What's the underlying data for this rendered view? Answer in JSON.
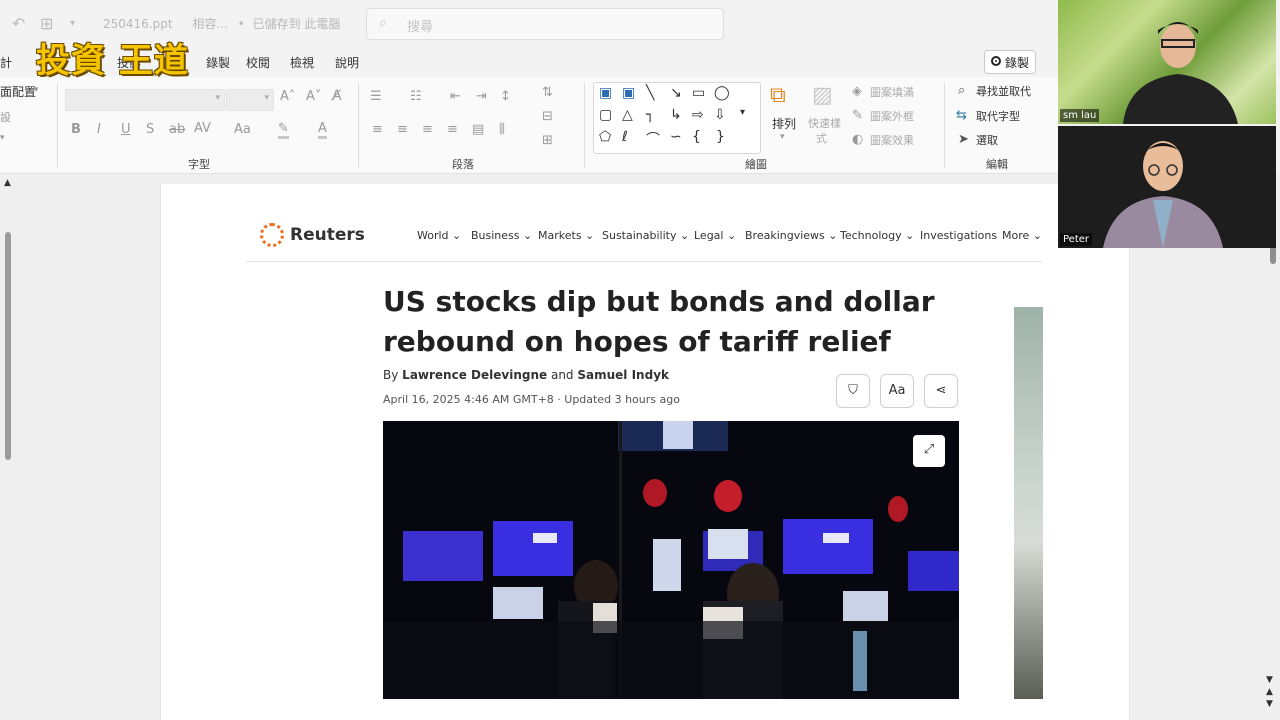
{
  "window": {
    "filename": "250416.ppt",
    "compat": "相容...",
    "save_status": "已儲存到 此電腦",
    "search_placeholder": "搜尋"
  },
  "channel_logo": "投資 王道",
  "menu": {
    "tabs": [
      "計",
      "繪",
      "投影",
      "檢視",
      "錄製",
      "校閱",
      "檢視",
      "說明"
    ],
    "record_label": "錄製"
  },
  "ribbon": {
    "font_group_label": "字型",
    "paragraph_group_label": "段落",
    "drawing_group_label": "繪圖",
    "editing_group_label": "編輯",
    "layout_label": "面配置",
    "arrange_label": "排列",
    "quick_styles_label_1": "快速樣",
    "quick_styles_label_2": "式",
    "shape_fill": "圖案填滿",
    "shape_outline": "圖案外框",
    "shape_effects": "圖案效果",
    "find_replace": "尋找並取代",
    "replace_font": "取代字型",
    "select": "選取"
  },
  "article": {
    "brand": "Reuters",
    "nav": [
      "World",
      "Business",
      "Markets",
      "Sustainability",
      "Legal",
      "Breakingviews",
      "Technology",
      "Investigations",
      "More"
    ],
    "headline": "US stocks dip but bonds and dollar rebound on hopes of tariff relief",
    "by": "By",
    "author1": "Lawrence Delevingne",
    "and": "and",
    "author2": "Samuel Indyk",
    "dateline": "April 16, 2025 4:46 AM GMT+8 · Updated 3 hours ago",
    "font_button": "Aa"
  },
  "participants": [
    {
      "name": "sm lau"
    },
    {
      "name": "Peter"
    }
  ]
}
